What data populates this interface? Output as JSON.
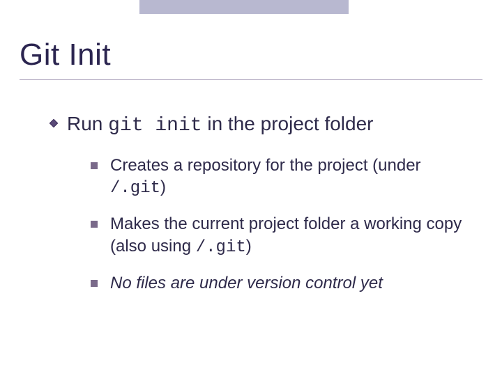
{
  "title": "Git Init",
  "main": {
    "pre": "Run ",
    "code": "git init",
    "post": " in the project folder"
  },
  "subs": [
    {
      "pre": "Creates a repository for the project (under ",
      "code": "/.git",
      "post": ")",
      "italic": false
    },
    {
      "pre": "Makes the current project folder a working copy (also using ",
      "code": "/.git",
      "post": ")",
      "italic": false
    },
    {
      "pre": "No files are under version control yet",
      "code": "",
      "post": "",
      "italic": true
    }
  ]
}
